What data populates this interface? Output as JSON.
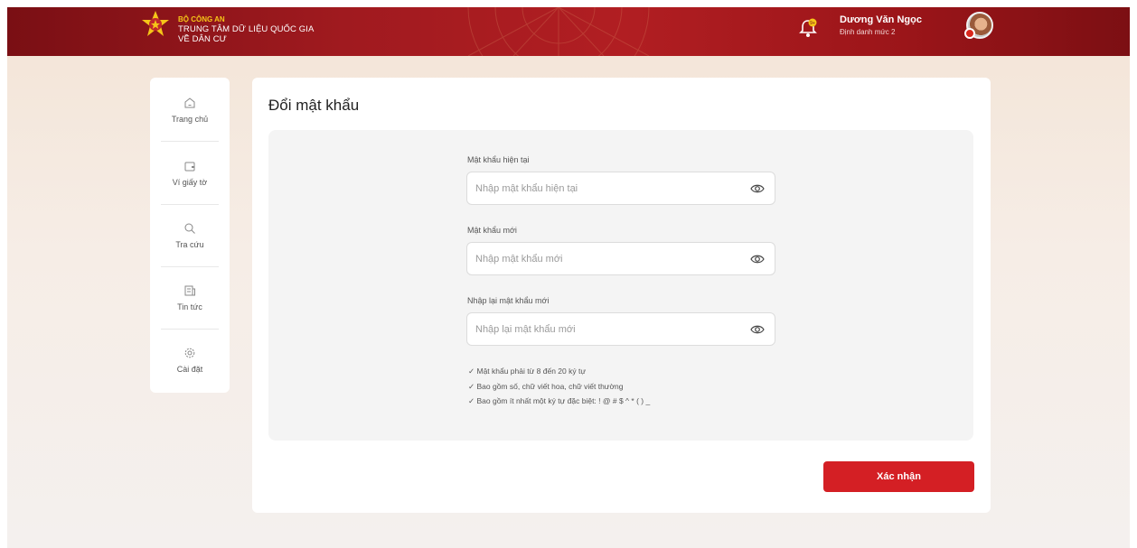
{
  "header": {
    "brand_top": "BỘ CÔNG AN",
    "brand_line1": "TRUNG TÂM DỮ LIỆU QUỐC GIA",
    "brand_line2": "VỀ DÂN CƯ",
    "user_name": "Dương Văn Ngọc",
    "user_level": "Định danh mức 2",
    "colors": {
      "primary": "#a01a1f",
      "gold": "#f5c518"
    }
  },
  "sidebar": {
    "items": [
      {
        "label": "Trang chủ",
        "icon": "home-icon"
      },
      {
        "label": "Ví giấy tờ",
        "icon": "wallet-icon"
      },
      {
        "label": "Tra cứu",
        "icon": "search-icon"
      },
      {
        "label": "Tin tức",
        "icon": "news-icon"
      },
      {
        "label": "Cài đặt",
        "icon": "settings-icon"
      }
    ]
  },
  "main": {
    "title": "Đổi mật khẩu",
    "fields": [
      {
        "label": "Mật khẩu hiện tại",
        "placeholder": "Nhập mật khẩu hiện tại",
        "value": ""
      },
      {
        "label": "Mật khẩu mới",
        "placeholder": "Nhập mật khẩu mới",
        "value": ""
      },
      {
        "label": "Nhập lại mật khẩu mới",
        "placeholder": "Nhập lại mật khẩu mới",
        "value": ""
      }
    ],
    "rules": [
      "✓ Mật khẩu phải từ 8 đến 20 ký tự",
      "✓ Bao gồm số, chữ viết hoa, chữ viết thường",
      "✓ Bao gồm ít nhất một ký tự đặc biệt: ! @ # $ ^ * ( ) _"
    ],
    "submit_label": "Xác nhận",
    "submit_color": "#d41f24"
  }
}
